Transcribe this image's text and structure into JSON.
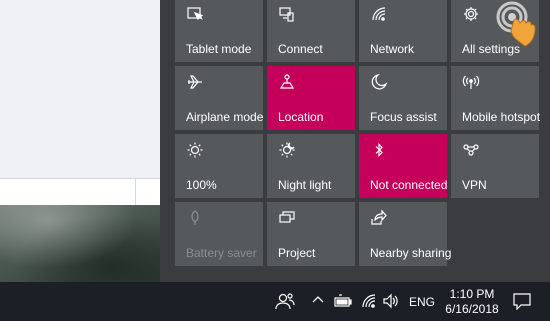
{
  "action_center": {
    "tiles": [
      {
        "label": "Tablet mode",
        "icon": "tablet-mode-icon"
      },
      {
        "label": "Connect",
        "icon": "connect-icon"
      },
      {
        "label": "Network",
        "icon": "network-icon"
      },
      {
        "label": "All settings",
        "icon": "gear-icon"
      },
      {
        "label": "Airplane mode",
        "icon": "airplane-icon"
      },
      {
        "label": "Location",
        "icon": "location-icon",
        "active": true
      },
      {
        "label": "Focus assist",
        "icon": "moon-icon"
      },
      {
        "label": "Mobile hotspot",
        "icon": "hotspot-icon"
      },
      {
        "label": "100%",
        "icon": "brightness-icon"
      },
      {
        "label": "Night light",
        "icon": "night-light-icon"
      },
      {
        "label": "Not connected",
        "icon": "bluetooth-icon",
        "active": true
      },
      {
        "label": "VPN",
        "icon": "vpn-icon"
      },
      {
        "label": "Battery saver",
        "icon": "battery-saver-icon",
        "disabled": true
      },
      {
        "label": "Project",
        "icon": "project-icon"
      },
      {
        "label": "Nearby sharing",
        "icon": "nearby-sharing-icon"
      }
    ],
    "active_color": "#c5005a",
    "tile_color": "#56595c"
  },
  "taskbar": {
    "language": "ENG",
    "time": "1:10 PM",
    "date": "6/16/2018",
    "tray_icons": [
      "people-icon",
      "chevron-up-icon",
      "battery-icon",
      "wifi-icon",
      "volume-icon",
      "notification-icon"
    ]
  }
}
